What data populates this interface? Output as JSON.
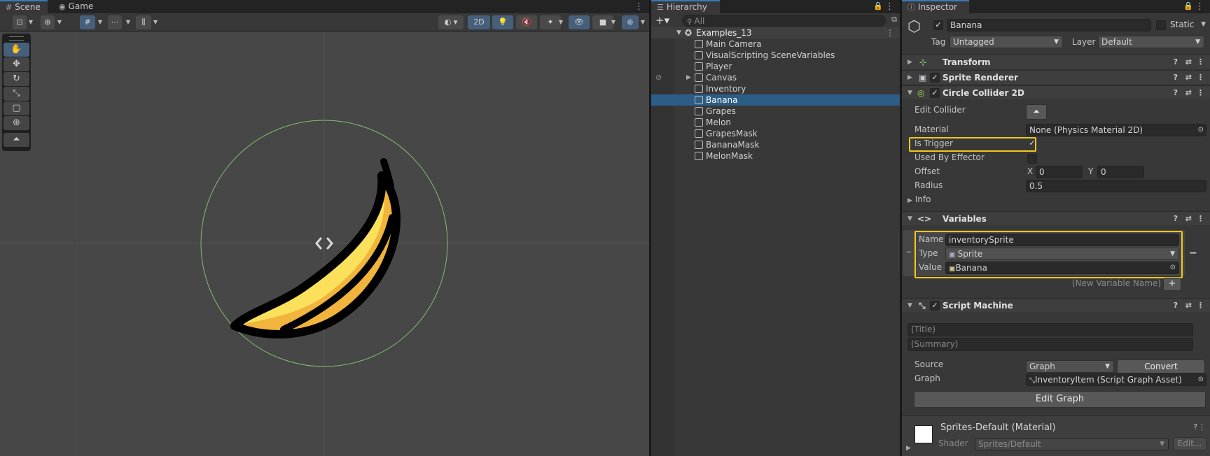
{
  "scene": {
    "tabs": [
      {
        "label": "Scene",
        "icon": "scene-icon"
      },
      {
        "label": "Game",
        "icon": "game-icon"
      }
    ],
    "toolbar_2d_label": "2D",
    "tools": [
      "hand-tool-icon",
      "move-tool-icon",
      "rotate-tool-icon",
      "scale-tool-icon",
      "rect-tool-icon",
      "transform-tool-icon",
      "edit-collider-tool-icon"
    ]
  },
  "hierarchy": {
    "tab": "Hierarchy",
    "search_placeholder": "All",
    "root": "Examples_13",
    "items": [
      {
        "label": "Main Camera",
        "selected": false,
        "expandable": false
      },
      {
        "label": "VisualScripting SceneVariables",
        "selected": false,
        "expandable": false
      },
      {
        "label": "Player",
        "selected": false,
        "expandable": false
      },
      {
        "label": "Canvas",
        "selected": false,
        "expandable": true
      },
      {
        "label": "Inventory",
        "selected": false,
        "expandable": false
      },
      {
        "label": "Banana",
        "selected": true,
        "expandable": false
      },
      {
        "label": "Grapes",
        "selected": false,
        "expandable": false
      },
      {
        "label": "Melon",
        "selected": false,
        "expandable": false
      },
      {
        "label": "GrapesMask",
        "selected": false,
        "expandable": false
      },
      {
        "label": "BananaMask",
        "selected": false,
        "expandable": false
      },
      {
        "label": "MelonMask",
        "selected": false,
        "expandable": false
      }
    ]
  },
  "inspector": {
    "tab": "Inspector",
    "object_name": "Banana",
    "static_label": "Static",
    "tag_label": "Tag",
    "tag_value": "Untagged",
    "layer_label": "Layer",
    "layer_value": "Default",
    "components": {
      "transform": "Transform",
      "sprite_renderer": "Sprite Renderer",
      "circle_collider": "Circle Collider 2D",
      "variables": "Variables",
      "script_machine": "Script Machine"
    },
    "collider": {
      "edit_collider": "Edit Collider",
      "material_label": "Material",
      "material_value": "None (Physics Material 2D)",
      "is_trigger_label": "Is Trigger",
      "is_trigger": "✓",
      "used_by_effector_label": "Used By Effector",
      "offset_label": "Offset",
      "offset_x_label": "X",
      "offset_x": "0",
      "offset_y_label": "Y",
      "offset_y": "0",
      "radius_label": "Radius",
      "radius": "0.5",
      "info_label": "Info"
    },
    "variables": {
      "name_label": "Name",
      "name_value": "inventorySprite",
      "type_label": "Type",
      "type_value": "Sprite",
      "value_label": "Value",
      "value_value": "Banana",
      "new_variable_placeholder": "(New Variable Name)"
    },
    "script_machine": {
      "title_placeholder": "(Title)",
      "summary_placeholder": "(Summary)",
      "source_label": "Source",
      "source_value": "Graph",
      "convert_button": "Convert",
      "graph_label": "Graph",
      "graph_value": "InventoryItem (Script Graph Asset)",
      "edit_graph_button": "Edit Graph"
    },
    "material": {
      "name": "Sprites-Default (Material)",
      "shader_label": "Shader",
      "shader_value": "Sprites/Default",
      "edit_button": "Edit..."
    }
  },
  "colors": {
    "accent": "#3a79bb",
    "highlight": "#f2c81d",
    "selection": "#2c5d87"
  }
}
